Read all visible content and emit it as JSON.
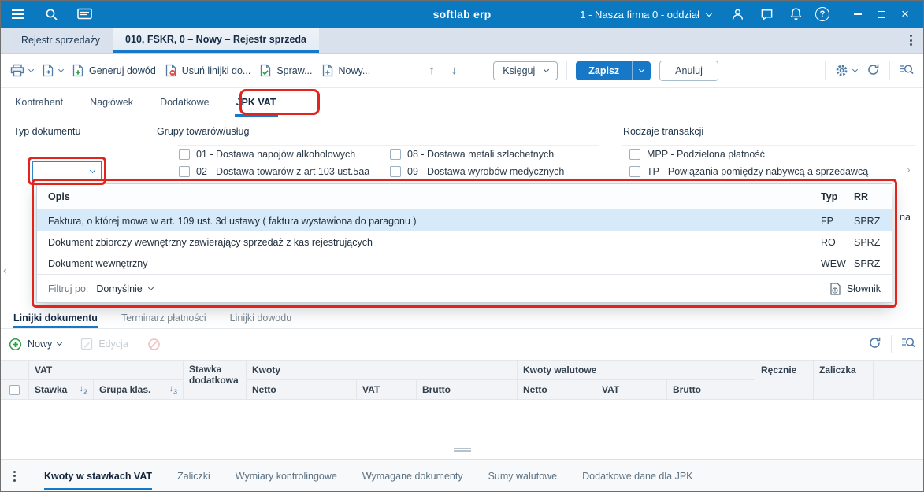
{
  "topbar": {
    "app_title": "softlab erp",
    "company": "1 - Nasza firma 0 - oddział"
  },
  "window_tabs": {
    "tab1": "Rejestr sprzedaży",
    "tab2": "010, FSKR, 0 – Nowy – Rejestr sprzeda"
  },
  "toolbar": {
    "generuj": "Generuj dowód",
    "usun": "Usuń linijki do...",
    "spraw": "Spraw...",
    "nowy": "Nowy...",
    "ksieguj": "Księguj",
    "zapisz": "Zapisz",
    "anuluj": "Anuluj"
  },
  "subtabs": {
    "t1": "Kontrahent",
    "t2": "Nagłówek",
    "t3": "Dodatkowe",
    "t4": "JPK VAT"
  },
  "jpk": {
    "typ_label": "Typ dokumentu",
    "grupy_label": "Grupy towarów/usług",
    "g1": "01 - Dostawa napojów alkoholowych",
    "g2": "02 - Dostawa towarów z art 103 ust.5aa",
    "g8": "08 - Dostawa metali szlachetnych",
    "g9": "09 - Dostawa wyrobów medycznych",
    "rodzaje_label": "Rodzaje transakcji",
    "r1": "MPP - Podzielona płatność",
    "r2": "TP - Powiązania pomiędzy nabywcą a sprzedawcą",
    "fragment": "na"
  },
  "dropdown": {
    "col_opis": "Opis",
    "col_typ": "Typ",
    "col_rr": "RR",
    "rows": [
      {
        "opis": "Faktura, o której mowa w art. 109 ust. 3d ustawy ( faktura wystawiona do paragonu )",
        "typ": "FP",
        "rr": "SPRZ"
      },
      {
        "opis": "Dokument zbiorczy wewnętrzny zawierający sprzedaż z kas rejestrujących",
        "typ": "RO",
        "rr": "SPRZ"
      },
      {
        "opis": "Dokument wewnętrzny",
        "typ": "WEW",
        "rr": "SPRZ"
      }
    ],
    "filtruj_label": "Filtruj po:",
    "filtruj_value": "Domyślnie",
    "slownik": "Słownik"
  },
  "lower_tabs": {
    "t1": "Linijki dokumentu",
    "t2": "Terminarz płatności",
    "t3": "Linijki dowodu"
  },
  "lower_toolbar": {
    "nowy": "Nowy",
    "edycja": "Edycja"
  },
  "table": {
    "vat_group": "VAT",
    "stawka_dodatkowa": "Stawka dodatkowa",
    "kwoty": "Kwoty",
    "kwoty_walutowe": "Kwoty walutowe",
    "recznie": "Ręcznie",
    "zaliczka": "Zaliczka",
    "stawka": "Stawka",
    "grupa_klas": "Grupa klas.",
    "netto": "Netto",
    "vat": "VAT",
    "brutto": "Brutto",
    "sort_stawka": "2",
    "sort_grupa": "3"
  },
  "bottom_tabs": {
    "t1": "Kwoty w stawkach VAT",
    "t2": "Zaliczki",
    "t3": "Wymiary kontrolingowe",
    "t4": "Wymagane dokumenty",
    "t5": "Sumy walutowe",
    "t6": "Dodatkowe dane dla JPK"
  },
  "colors": {
    "accent": "#1878c8",
    "topbar": "#0a79bf",
    "annotation": "#e2241c",
    "selected_row": "#d7eaf9"
  }
}
